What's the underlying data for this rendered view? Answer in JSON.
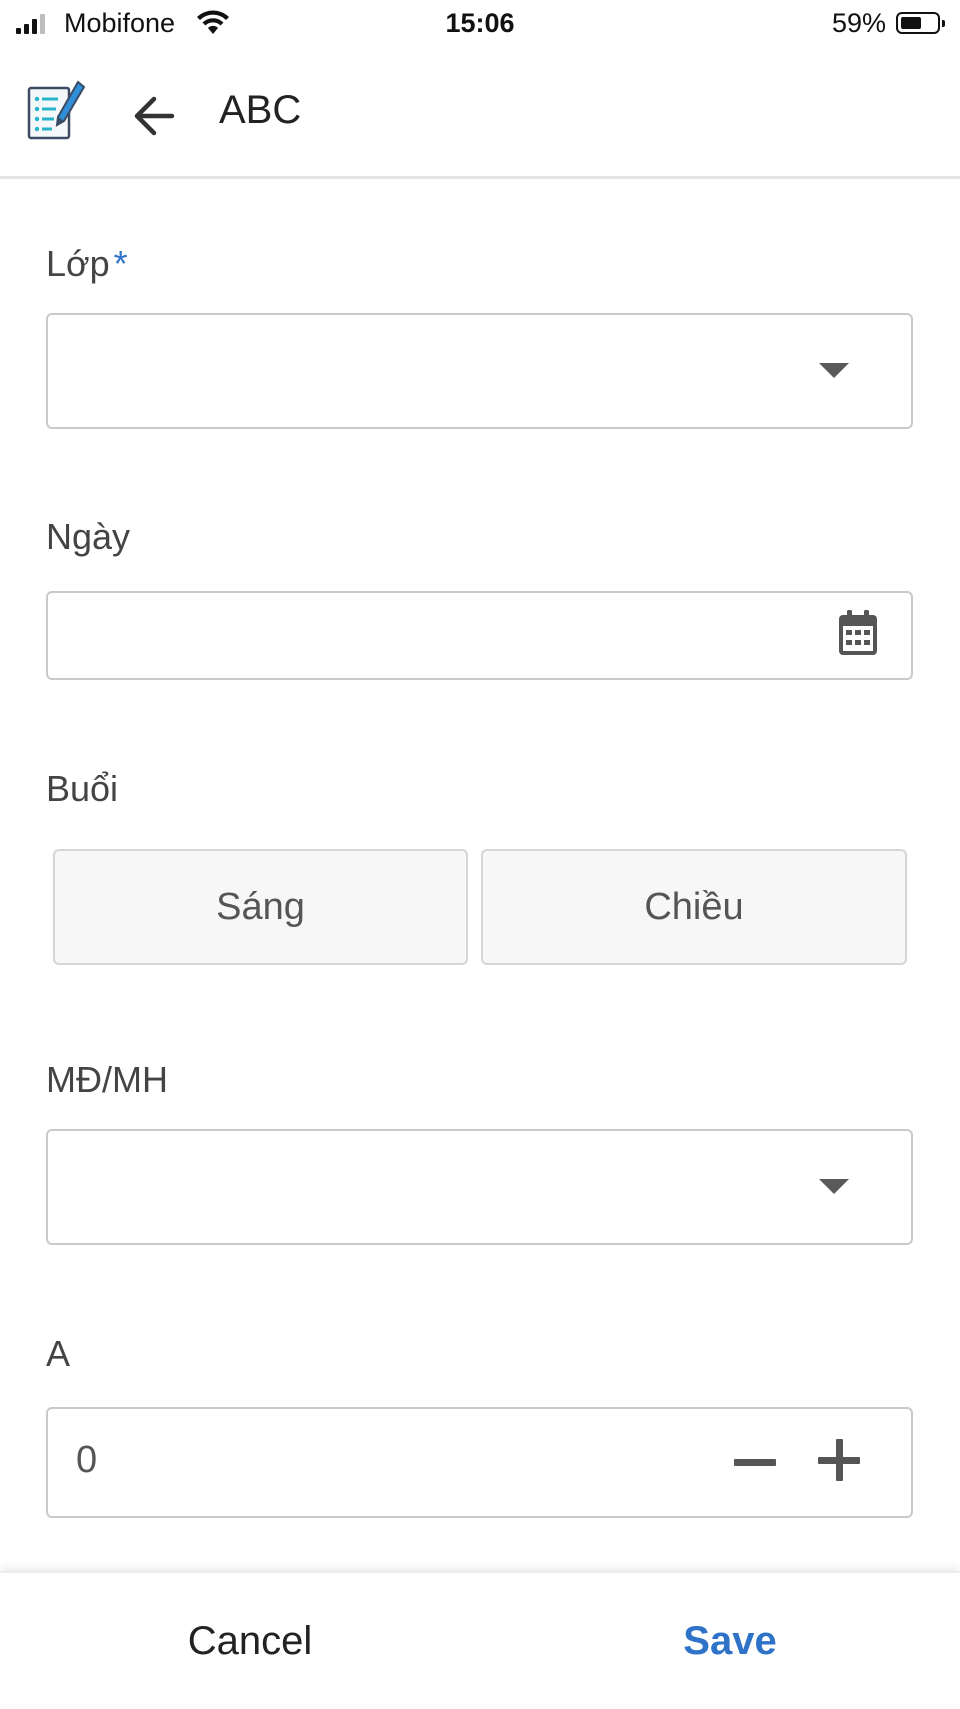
{
  "status_bar": {
    "carrier": "Mobifone",
    "time": "15:06",
    "battery": "59%",
    "battery_level": 0.59
  },
  "header": {
    "title": "ABC"
  },
  "form": {
    "lop": {
      "label": "Lớp",
      "required_mark": "*",
      "value": ""
    },
    "ngay": {
      "label": "Ngày",
      "value": ""
    },
    "buoi": {
      "label": "Buổi",
      "options": [
        "Sáng",
        "Chiều"
      ]
    },
    "md_mh": {
      "label": "MĐ/MH",
      "value": ""
    },
    "a": {
      "label": "A",
      "value": "0"
    }
  },
  "footer": {
    "cancel_label": "Cancel",
    "save_label": "Save"
  },
  "colors": {
    "accent": "#2f73c8",
    "border": "#c9c9c9",
    "segment_bg": "#f7f7f7"
  },
  "icons": {
    "app": "form-edit-icon",
    "back": "arrow-left-icon",
    "dropdown": "caret-down-icon",
    "date": "calendar-icon",
    "decrement": "minus-icon",
    "increment": "plus-icon"
  }
}
